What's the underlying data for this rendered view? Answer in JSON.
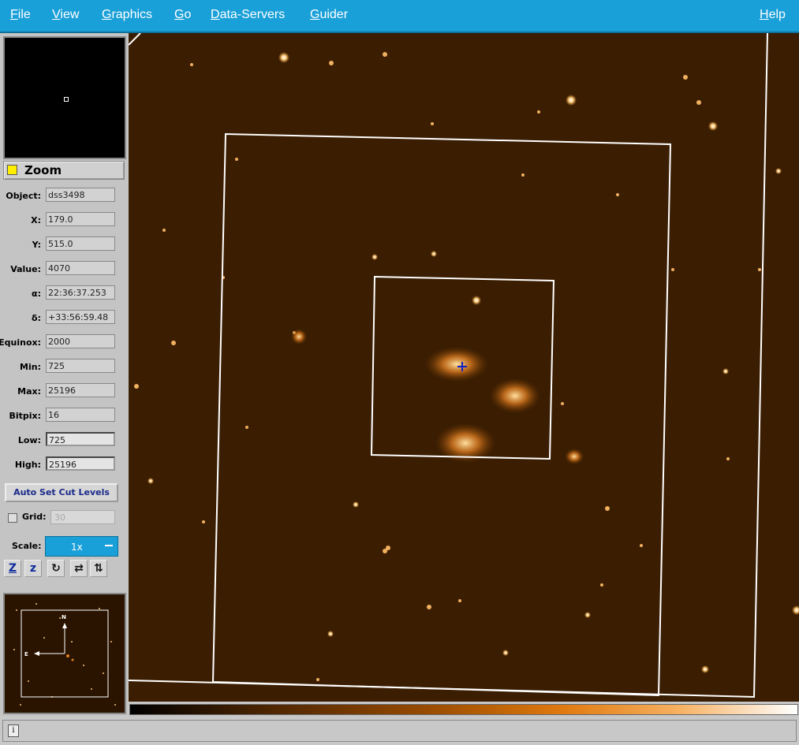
{
  "menubar": {
    "items": [
      {
        "label": "File",
        "u": "F",
        "rest": "ile"
      },
      {
        "label": "View",
        "u": "V",
        "rest": "iew"
      },
      {
        "label": "Graphics",
        "u": "G",
        "rest": "raphics"
      },
      {
        "label": "Go",
        "u": "G",
        "rest": "o"
      },
      {
        "label": "Data-Servers",
        "u": "D",
        "rest": "ata-Servers"
      },
      {
        "label": "Guider",
        "u": "G",
        "rest": "uider"
      },
      {
        "label": "Help",
        "u": "H",
        "rest": "elp"
      }
    ]
  },
  "zoom": {
    "label": "Zoom",
    "enabled": true
  },
  "info": {
    "object": {
      "label": "Object:",
      "value": "dss3498"
    },
    "x": {
      "label": "X:",
      "value": "179.0"
    },
    "y": {
      "label": "Y:",
      "value": "515.0"
    },
    "value": {
      "label": "Value:",
      "value": "4070"
    },
    "alpha": {
      "label": "α:",
      "value": "22:36:37.253"
    },
    "delta": {
      "label": "δ:",
      "value": "+33:56:59.48"
    },
    "equinox": {
      "label": "Equinox:",
      "value": "2000"
    },
    "min": {
      "label": "Min:",
      "value": "725"
    },
    "max": {
      "label": "Max:",
      "value": "25196"
    },
    "bitpix": {
      "label": "Bitpix:",
      "value": "16"
    },
    "low": {
      "label": "Low:",
      "value": "725"
    },
    "high": {
      "label": "High:",
      "value": "25196"
    }
  },
  "auto_cut_button": "Auto Set Cut Levels",
  "grid": {
    "label": "Grid:",
    "value": "30",
    "checked": false
  },
  "scale": {
    "label": "Scale:",
    "value": "1x"
  },
  "tools": [
    "Z",
    "z",
    "↻",
    "⇄",
    "⇅"
  ],
  "pan": {
    "north": "N",
    "east": "E"
  },
  "status": {
    "icon": "i",
    "text": ""
  },
  "colors": {
    "menubar": "#1aa0d8",
    "accent": "#1aa0d8",
    "image_bg": "#3a1d00",
    "cursor": "#1020c0"
  }
}
